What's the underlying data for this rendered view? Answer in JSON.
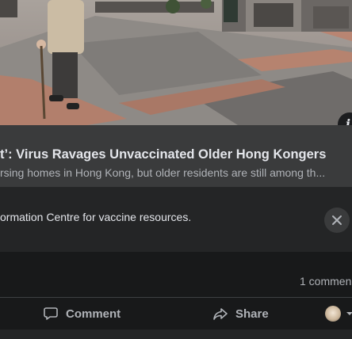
{
  "post": {
    "link_title": "t’: Virus Ravages Unvaccinated Older Hong Kongers",
    "link_subtitle": "rsing homes in Hong Kong, but older residents are still among th...",
    "info_icon": "i"
  },
  "notice": {
    "text": "ormation Centre for vaccine resources."
  },
  "stats": {
    "comment_count": "1 commen"
  },
  "actions": {
    "comment_label": "Comment",
    "share_label": "Share"
  },
  "colors": {
    "background": "#18191a",
    "caption_bg": "#3a3b3c",
    "notice_bg": "#242526",
    "text_primary": "#e4e6eb",
    "text_secondary": "#b0b3b8"
  }
}
